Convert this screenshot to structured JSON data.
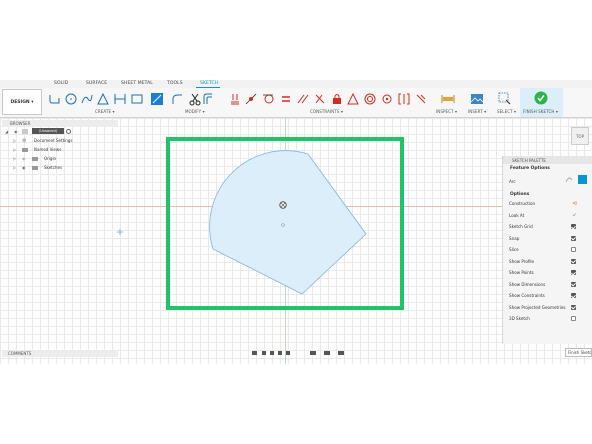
{
  "tabs": [
    "SOLID",
    "SURFACE",
    "SHEET METAL",
    "TOOLS",
    "SKETCH"
  ],
  "active_tab": "SKETCH",
  "workspace_button": "DESIGN ▾",
  "toolbar_groups": {
    "create": "CREATE ▾",
    "modify": "MODIFY ▾",
    "constraints": "CONSTRAINTS ▾",
    "inspect": "INSPECT ▾",
    "insert": "INSERT ▾",
    "select": "SELECT ▾",
    "finish_sketch": "FINISH SKETCH ▾"
  },
  "browser": {
    "title": "BROWSER",
    "root": "(Unsaved)",
    "items": [
      "Document Settings",
      "Named Views",
      "Origin",
      "Sketches"
    ]
  },
  "comments": "COMMENTS",
  "viewcube": "TOP",
  "sketch_palette": {
    "title": "SKETCH PALETTE",
    "feature_options": "Feature Options",
    "arc_label": "Arc",
    "options_label": "Options",
    "rows": [
      {
        "label": "Construction",
        "state": "icon"
      },
      {
        "label": "Look At",
        "state": "icon"
      },
      {
        "label": "Sketch Grid",
        "state": "on"
      },
      {
        "label": "Snap",
        "state": "on"
      },
      {
        "label": "Slice",
        "state": "off"
      },
      {
        "label": "Show Profile",
        "state": "on"
      },
      {
        "label": "Show Points",
        "state": "on"
      },
      {
        "label": "Show Dimensions",
        "state": "on"
      },
      {
        "label": "Show Constraints",
        "state": "on"
      },
      {
        "label": "Show Projected Geometries",
        "state": "on"
      },
      {
        "label": "3D Sketch",
        "state": "off"
      }
    ],
    "finish_input": "Finish Sketch"
  },
  "colors": {
    "accent": "#0696d7",
    "highlight": "#21c36a",
    "profile_fill": "#dbeefa",
    "profile_stroke": "#7fb6dc",
    "finish_check": "#2cb34a"
  }
}
